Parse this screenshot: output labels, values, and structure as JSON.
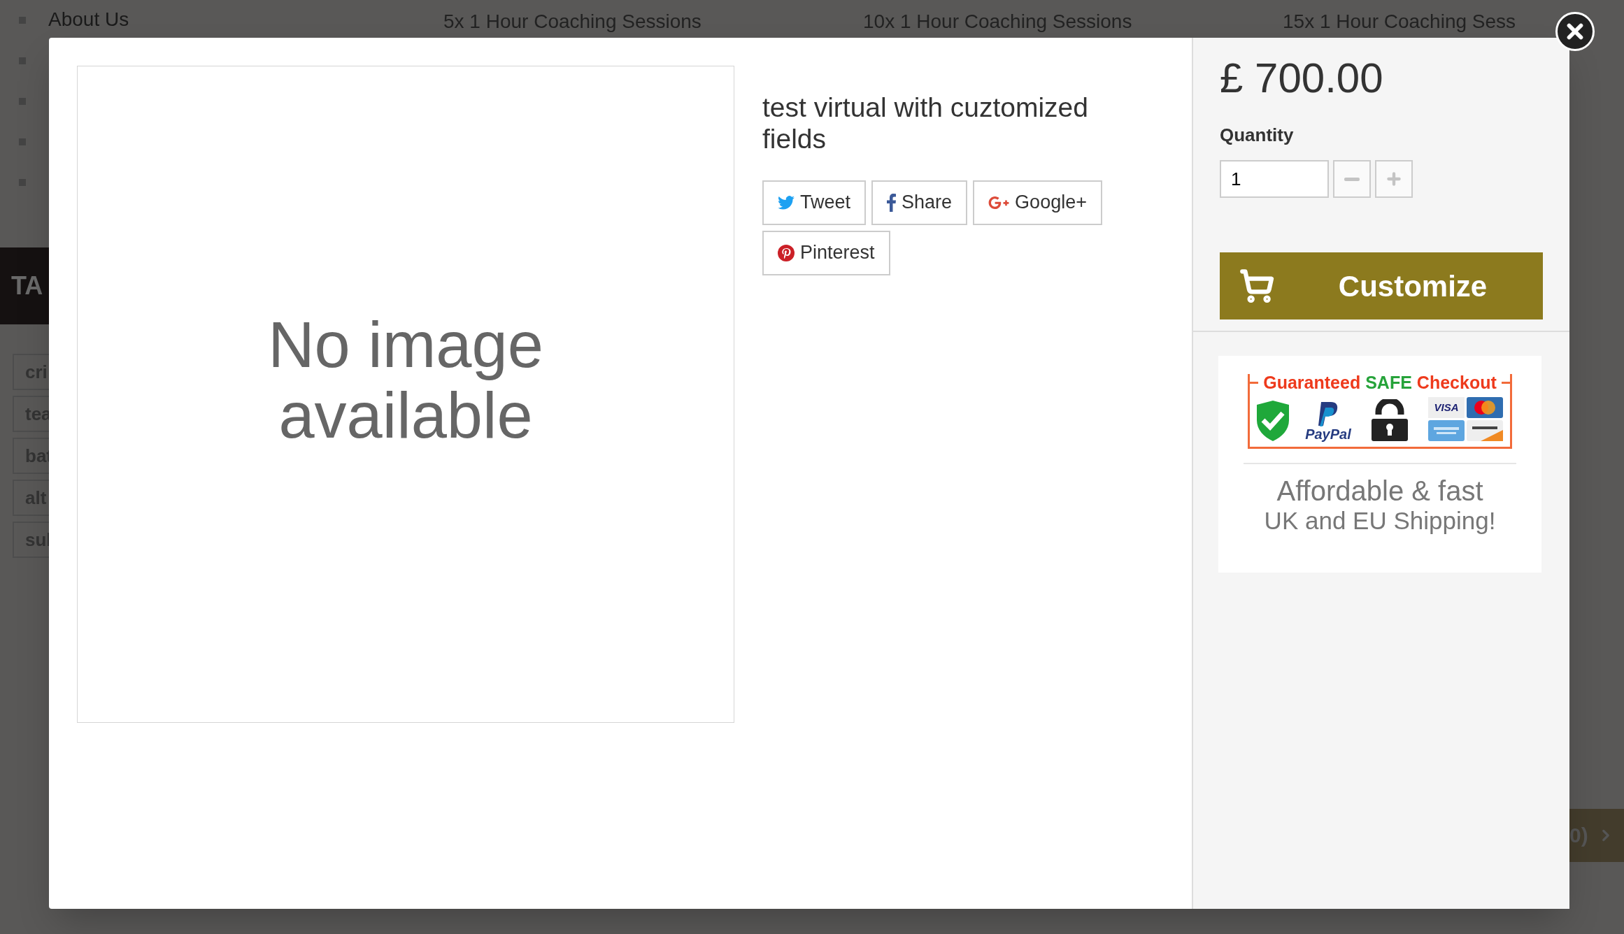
{
  "background": {
    "menu_link": "About Us",
    "tabs": [
      "5x 1 Hour Coaching Sessions",
      "10x 1 Hour Coaching Sessions",
      "15x 1 Hour Coaching Sess"
    ],
    "heading": "TA",
    "tags": [
      "cri",
      "tea",
      "bat",
      "alt",
      "sul"
    ],
    "cart_fragment": "0)"
  },
  "modal": {
    "image_placeholder": "No image available",
    "title": "test virtual with cuztomized fields",
    "share_buttons": [
      {
        "kind": "twitter",
        "label": "Tweet"
      },
      {
        "kind": "facebook",
        "label": "Share"
      },
      {
        "kind": "googleplus",
        "label": "Google+"
      },
      {
        "kind": "pinterest",
        "label": "Pinterest"
      }
    ],
    "price": "£ 700.00",
    "quantity": {
      "label": "Quantity",
      "value": "1"
    },
    "customize_button": "Customize",
    "badge": {
      "title": [
        "Guaranteed",
        "SAFE",
        "Checkout"
      ],
      "paypal": "PayPal",
      "visa": "VISA",
      "shipping": [
        "Affordable & fast",
        "UK and EU Shipping!"
      ]
    }
  }
}
